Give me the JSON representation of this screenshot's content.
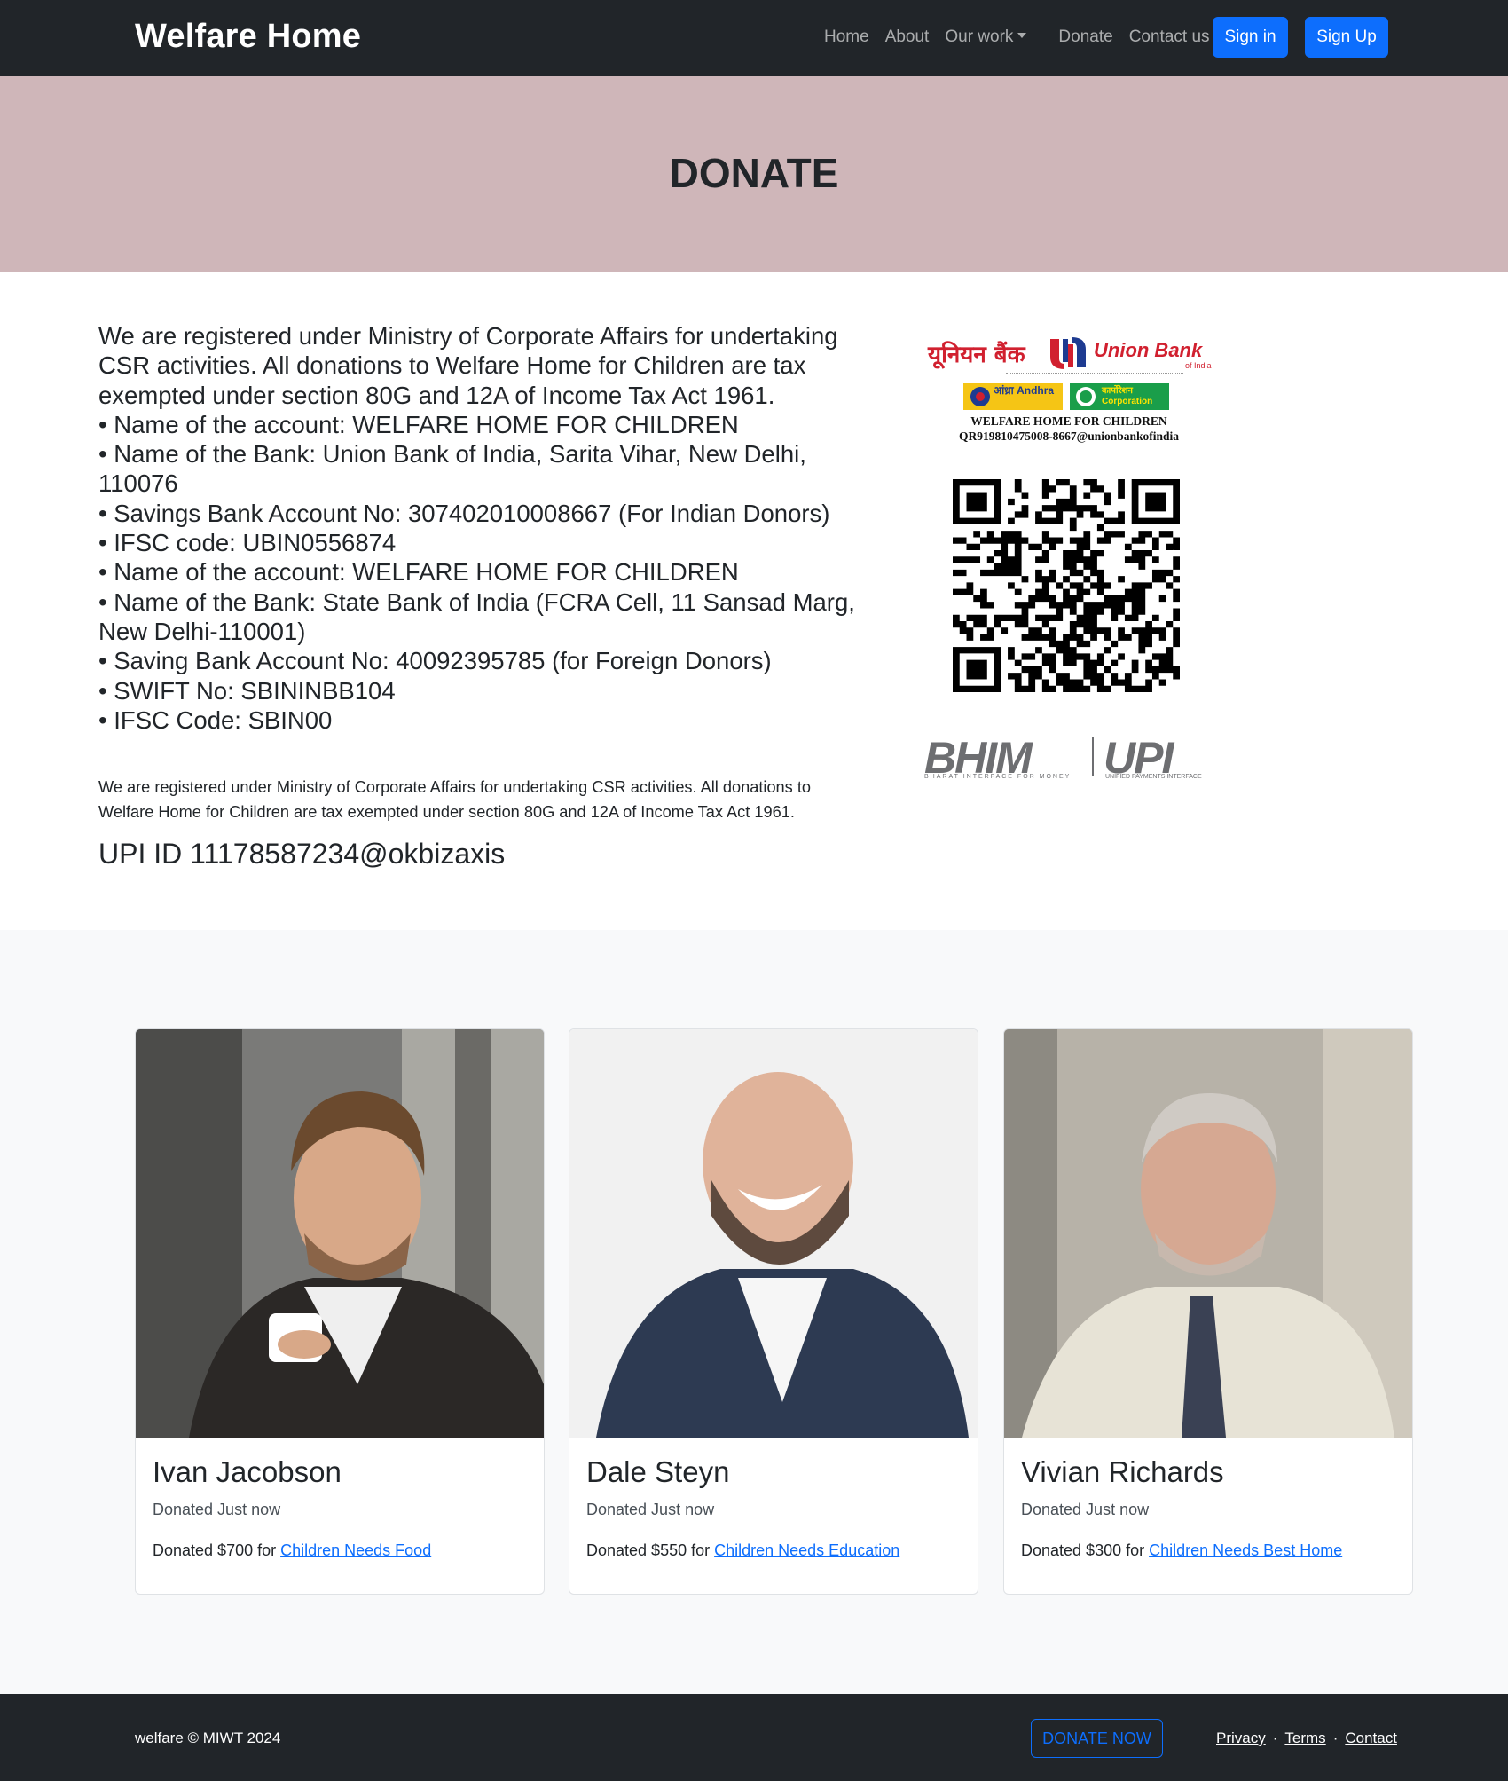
{
  "navbar": {
    "brand": "Welfare Home",
    "links": [
      "Home",
      "About",
      "Our work",
      "Donate",
      "Contact us"
    ],
    "sign_in": "Sign in",
    "sign_up": "Sign Up"
  },
  "hero": {
    "title": "DONATE"
  },
  "donation_info": {
    "intro": "We are registered under Ministry of Corporate Affairs for undertaking CSR activities. All donations to Welfare Home for Children are tax exempted under section 80G and 12A of Income Tax Act 1961.",
    "lines": [
      "• Name of the account: WELFARE HOME FOR CHILDREN",
      "• Name of the Bank: Union Bank of India, Sarita Vihar, New Delhi, 110076",
      "• Savings Bank Account No: 307402010008667 (For Indian Donors)",
      "• IFSC code: UBIN0556874",
      "• Name of the account: WELFARE HOME FOR CHILDREN",
      "• Name of the Bank: State Bank of India (FCRA Cell, 11 Sansad Marg, New Delhi-110001)",
      "• Saving Bank Account No: 40092395785 (for Foreign Donors)",
      "• SWIFT No: SBININBB104",
      "• IFSC Code: SBIN00"
    ],
    "note": "We are registered under Ministry of Corporate Affairs for undertaking CSR activities. All donations to Welfare Home for Children are tax exempted under section 80G and 12A of Income Tax Act 1961.",
    "upi_id": "UPI ID 11178587234@okbizaxis"
  },
  "payment_image": {
    "bank_hindi": "यूनियन बैंक",
    "bank_english": "Union Bank",
    "bank_sub": "of India",
    "andhra_label": "आंध्रा Andhra",
    "corp_label": "कार्पोरेशन Corporation",
    "account_name": "WELFARE HOME FOR CHILDREN",
    "qr_ref": "QR919810475008-8667@unionbankofindia",
    "bhim": "BHIM",
    "upi": "UPI",
    "bhim_tag": "BHARAT INTERFACE FOR MONEY",
    "upi_tag": "UNIFIED PAYMENTS INTERFACE"
  },
  "donors": [
    {
      "name": "Ivan Jacobson",
      "time": "Donated Just now",
      "prefix": "Donated $700 for ",
      "cause": "Children Needs Food"
    },
    {
      "name": "Dale Steyn",
      "time": "Donated Just now",
      "prefix": "Donated $550 for ",
      "cause": "Children Needs Education"
    },
    {
      "name": "Vivian Richards",
      "time": "Donated Just now",
      "prefix": "Donated $300 for ",
      "cause": "Children Needs Best Home"
    }
  ],
  "footer": {
    "copyright": "welfare © MIWT 2024",
    "donate_now": "DONATE NOW",
    "links": [
      "Privacy",
      "Terms",
      "Contact"
    ],
    "separator": "·"
  },
  "colors": {
    "navbar": "#212529",
    "hero_bg": "#cfb6b9",
    "primary": "#0d6efd",
    "section_bg": "#f8f9fa"
  }
}
